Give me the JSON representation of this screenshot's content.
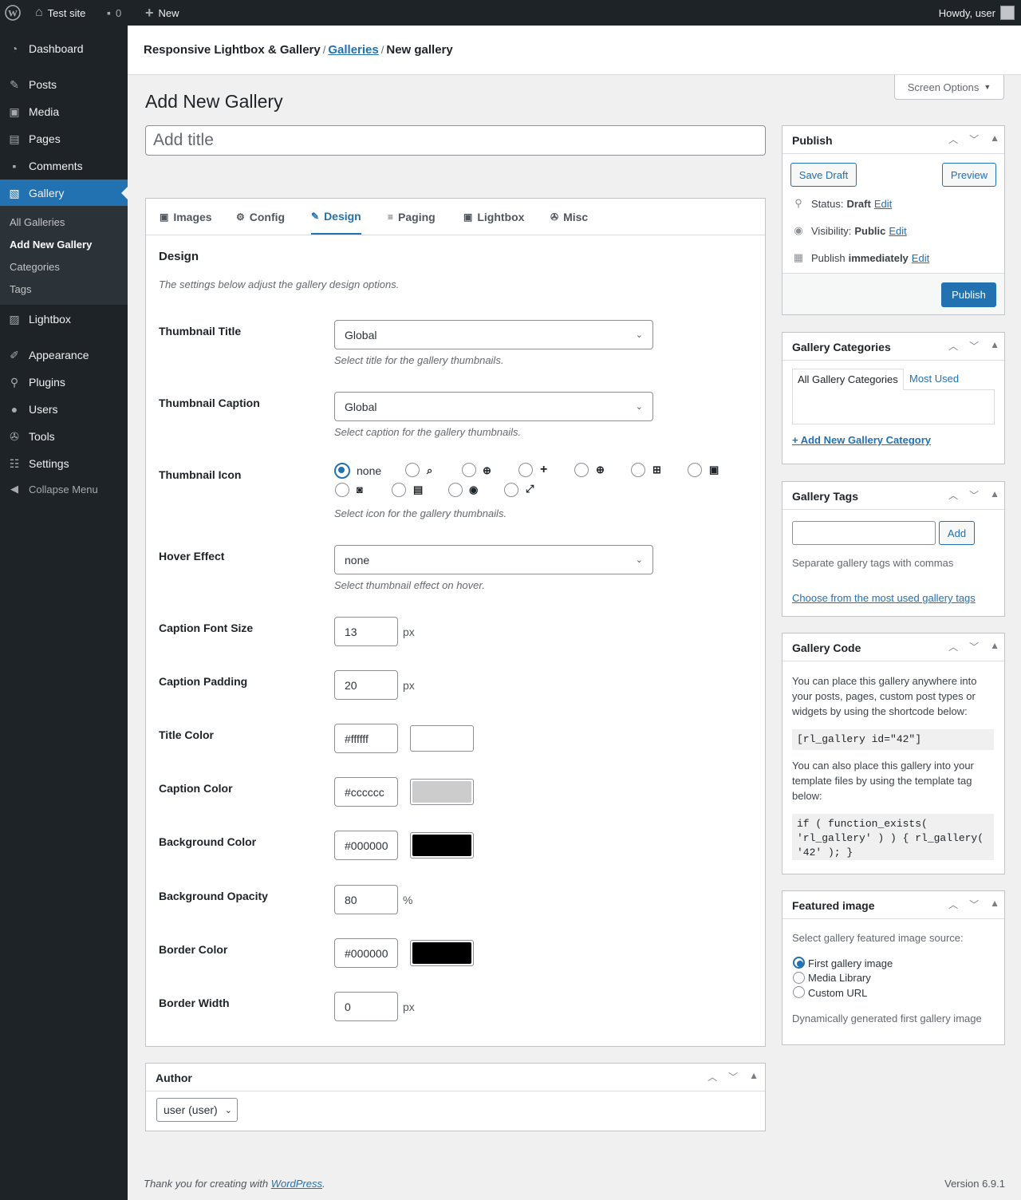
{
  "adminbar": {
    "site_name": "Test site",
    "comments_count": "0",
    "new_label": "New",
    "greeting": "Howdy, user"
  },
  "sidebar": {
    "items": [
      {
        "label": "Dashboard",
        "icon": "dashboard-icon"
      },
      {
        "label": "Posts",
        "icon": "pin-icon"
      },
      {
        "label": "Media",
        "icon": "media-icon"
      },
      {
        "label": "Pages",
        "icon": "pages-icon"
      },
      {
        "label": "Comments",
        "icon": "comments-icon"
      },
      {
        "label": "Gallery",
        "icon": "gallery-icon"
      },
      {
        "label": "Lightbox",
        "icon": "lightbox-icon"
      },
      {
        "label": "Appearance",
        "icon": "brush-icon"
      },
      {
        "label": "Plugins",
        "icon": "plugin-icon"
      },
      {
        "label": "Users",
        "icon": "user-icon"
      },
      {
        "label": "Tools",
        "icon": "wrench-icon"
      },
      {
        "label": "Settings",
        "icon": "settings-icon"
      },
      {
        "label": "Collapse Menu",
        "icon": "collapse-icon"
      }
    ],
    "submenu": [
      "All Galleries",
      "Add New Gallery",
      "Categories",
      "Tags"
    ]
  },
  "breadcrumb": {
    "plugin": "Responsive Lightbox & Gallery",
    "galleries": "Galleries",
    "current": "New gallery"
  },
  "screen_options": "Screen Options",
  "page_title": "Add New Gallery",
  "title_placeholder": "Add title",
  "tabs": [
    "Images",
    "Config",
    "Design",
    "Paging",
    "Lightbox",
    "Misc"
  ],
  "design": {
    "title": "Design",
    "description": "The settings below adjust the gallery design options.",
    "thumbnail_title": {
      "label": "Thumbnail Title",
      "value": "Global",
      "hint": "Select title for the gallery thumbnails."
    },
    "thumbnail_caption": {
      "label": "Thumbnail Caption",
      "value": "Global",
      "hint": "Select caption for the gallery thumbnails."
    },
    "thumbnail_icon": {
      "label": "Thumbnail Icon",
      "none_label": "none",
      "hint": "Select icon for the gallery thumbnails.",
      "selected": "none"
    },
    "hover_effect": {
      "label": "Hover Effect",
      "value": "none",
      "hint": "Select thumbnail effect on hover."
    },
    "caption_font_size": {
      "label": "Caption Font Size",
      "value": "13",
      "unit": "px"
    },
    "caption_padding": {
      "label": "Caption Padding",
      "value": "20",
      "unit": "px"
    },
    "title_color": {
      "label": "Title Color",
      "value": "#ffffff"
    },
    "caption_color": {
      "label": "Caption Color",
      "value": "#cccccc"
    },
    "background_color": {
      "label": "Background Color",
      "value": "#000000"
    },
    "background_opacity": {
      "label": "Background Opacity",
      "value": "80",
      "unit": "%"
    },
    "border_color": {
      "label": "Border Color",
      "value": "#000000"
    },
    "border_width": {
      "label": "Border Width",
      "value": "0",
      "unit": "px"
    }
  },
  "author": {
    "title": "Author",
    "value": "user (user)"
  },
  "publish": {
    "title": "Publish",
    "save_draft": "Save Draft",
    "preview": "Preview",
    "status_label": "Status:",
    "status_value": "Draft",
    "visibility_label": "Visibility:",
    "visibility_value": "Public",
    "publish_label": "Publish",
    "publish_value": "immediately",
    "edit": "Edit",
    "publish_button": "Publish"
  },
  "categories": {
    "title": "Gallery Categories",
    "tab_all": "All Gallery Categories",
    "tab_most": "Most Used",
    "add_link": "+ Add New Gallery Category"
  },
  "tags": {
    "title": "Gallery Tags",
    "add_button": "Add",
    "hint": "Separate gallery tags with commas",
    "choose_link": "Choose from the most used gallery tags"
  },
  "gallery_code": {
    "title": "Gallery Code",
    "text1": "You can place this gallery anywhere into your posts, pages, custom post types or widgets by using the shortcode below:",
    "shortcode": "[rl_gallery id=\"42\"]",
    "text2": "You can also place this gallery into your template files by using the template tag below:",
    "template_tag": "if ( function_exists( 'rl_gallery' ) ) { rl_gallery( '42' ); }"
  },
  "featured": {
    "title": "Featured image",
    "prompt": "Select gallery featured image source:",
    "options": [
      "First gallery image",
      "Media Library",
      "Custom URL"
    ],
    "selected": "First gallery image",
    "note": "Dynamically generated first gallery image"
  },
  "footer": {
    "thanks_prefix": "Thank you for creating with ",
    "wordpress": "WordPress",
    "suffix": ".",
    "version": "Version 6.9.1"
  },
  "colors": {
    "accent": "#2271b1",
    "adminbar": "#1d2327",
    "submenu": "#2c3338"
  }
}
